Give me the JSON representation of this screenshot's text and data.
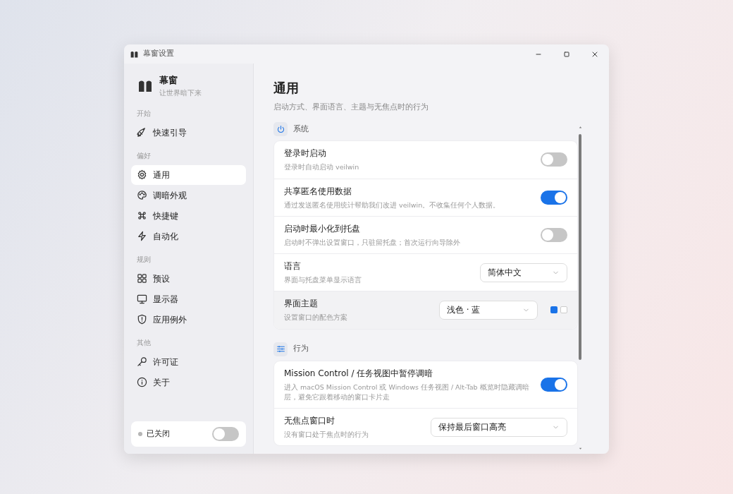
{
  "window": {
    "title": "幕窗设置"
  },
  "brand": {
    "name": "幕窗",
    "tagline": "让世界暗下来"
  },
  "sidebar": {
    "groups": [
      {
        "label": "开始",
        "items": [
          {
            "label": "快速引导",
            "selected": false
          }
        ]
      },
      {
        "label": "偏好",
        "items": [
          {
            "label": "通用",
            "selected": true
          },
          {
            "label": "调暗外观",
            "selected": false
          },
          {
            "label": "快捷键",
            "selected": false
          },
          {
            "label": "自动化",
            "selected": false
          }
        ]
      },
      {
        "label": "规则",
        "items": [
          {
            "label": "预设",
            "selected": false
          },
          {
            "label": "显示器",
            "selected": false
          },
          {
            "label": "应用例外",
            "selected": false
          }
        ]
      },
      {
        "label": "其他",
        "items": [
          {
            "label": "许可证",
            "selected": false
          },
          {
            "label": "关于",
            "selected": false
          }
        ]
      }
    ],
    "status": {
      "label": "已关闭",
      "on": false
    }
  },
  "page": {
    "title": "通用",
    "subtitle": "启动方式、界面语言、主题与无焦点时的行为"
  },
  "sections": [
    {
      "title": "系统",
      "rows": [
        {
          "kind": "toggle",
          "title": "登录时启动",
          "description": "登录时自动启动 veilwin",
          "on": false,
          "hovered": false
        },
        {
          "kind": "toggle",
          "title": "共享匿名使用数据",
          "description": "通过发送匿名使用统计帮助我们改进 veilwin。不收集任何个人数据。",
          "on": true,
          "hovered": false
        },
        {
          "kind": "toggle",
          "title": "启动时最小化到托盘",
          "description": "启动时不弹出设置窗口，只驻留托盘；首次运行向导除外",
          "on": false,
          "hovered": false
        },
        {
          "kind": "select",
          "title": "语言",
          "description": "界面与托盘菜单显示语言",
          "value": "简体中文",
          "hovered": false
        },
        {
          "kind": "theme",
          "title": "界面主题",
          "description": "设置窗口的配色方案",
          "value": "浅色 · 蓝",
          "hovered": true,
          "swatches": [
            {
              "color": "#1a73e8",
              "selected": true
            },
            {
              "color": "#ffffff",
              "selected": false
            }
          ]
        }
      ]
    },
    {
      "title": "行为",
      "rows": [
        {
          "kind": "toggle",
          "title": "Mission Control / 任务视图中暂停调暗",
          "description": "进入 macOS Mission Control 或 Windows 任务视图 / Alt-Tab 概览时隐藏调暗层，避免它跟着移动的窗口卡片走",
          "on": true,
          "hovered": false
        },
        {
          "kind": "select",
          "title": "无焦点窗口时",
          "description": "没有窗口处于焦点时的行为",
          "value": "保持最后窗口高亮",
          "hovered": false
        }
      ]
    }
  ]
}
